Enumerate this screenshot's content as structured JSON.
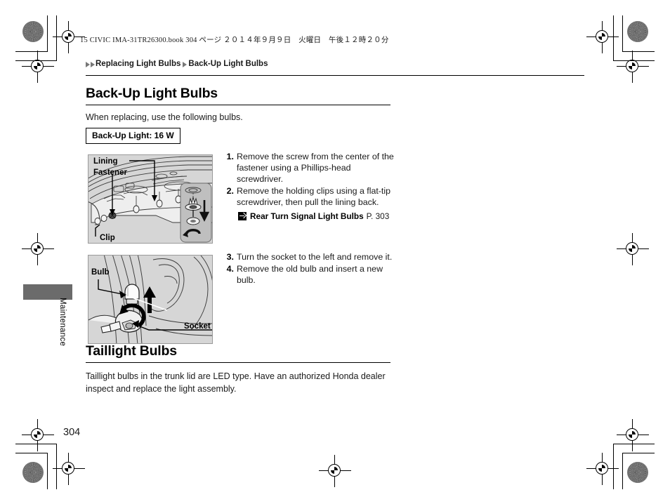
{
  "print_header": "15 CIVIC IMA-31TR26300.book  304 ページ  ２０１４年９月９日　火曜日　午後１２時２０分",
  "breadcrumb": {
    "parent": "Replacing Light Bulbs",
    "current": "Back-Up Light Bulbs"
  },
  "section1": {
    "title": "Back-Up Light Bulbs",
    "lead": "When replacing, use the following bulbs.",
    "spec": "Back-Up Light: 16 W",
    "steps": [
      {
        "num": "1.",
        "text": "Remove the screw from the center of the fastener using a Phillips-head screwdriver."
      },
      {
        "num": "2.",
        "text": "Remove the holding clips using a flat-tip screwdriver, then pull the lining back."
      },
      {
        "num": "3.",
        "text": "Turn the socket to the left and remove it."
      },
      {
        "num": "4.",
        "text": "Remove the old bulb and insert a new bulb."
      }
    ],
    "xref": {
      "icon": "jump-arrow-icon",
      "title": "Rear Turn Signal Light Bulbs",
      "page": "P. 303"
    },
    "figure1": {
      "labels": {
        "lining": "Lining",
        "fastener": "Fastener",
        "clip": "Clip"
      }
    },
    "figure2": {
      "labels": {
        "bulb": "Bulb",
        "socket": "Socket"
      }
    }
  },
  "section2": {
    "title": "Taillight Bulbs",
    "body": "Taillight bulbs in the trunk lid are LED type. Have an authorized Honda dealer inspect and replace the light assembly."
  },
  "side_tab": {
    "label": "Maintenance"
  },
  "page_number": "304",
  "colors": {
    "illustration_bg": "#d6d6d6",
    "side_tab": "#6b6b6b",
    "rule": "#000000"
  }
}
